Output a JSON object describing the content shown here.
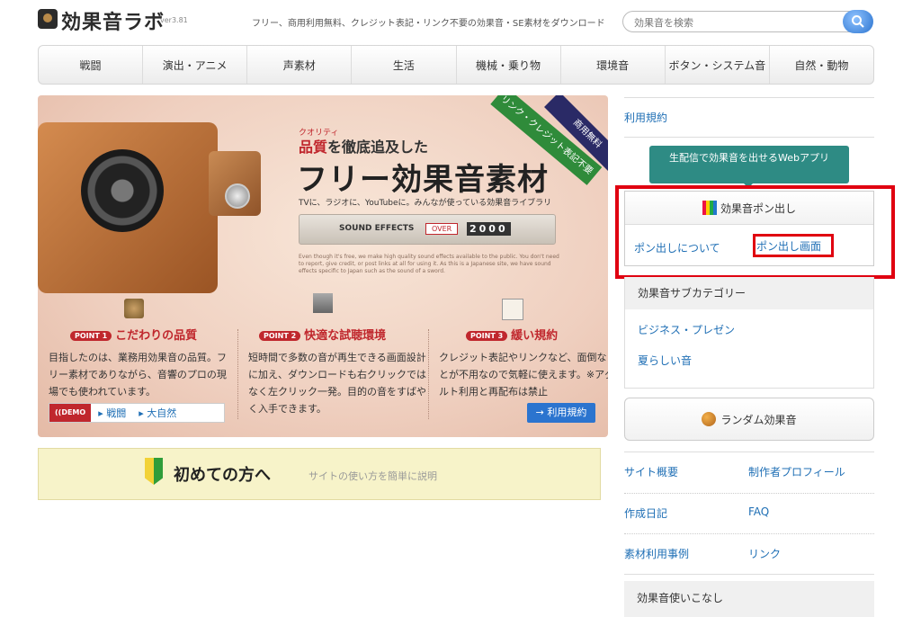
{
  "header": {
    "logo_text": "効果音ラボ",
    "version": "ver3.81",
    "tagline": "フリー、商用利用無料、クレジット表記・リンク不要の効果音・SE素材をダウンロード",
    "search_placeholder": "効果音を検索"
  },
  "nav": {
    "items": [
      "戦闘",
      "演出・アニメ",
      "声素材",
      "生活",
      "機械・乗り物",
      "環境音",
      "ボタン・システム音",
      "自然・動物"
    ]
  },
  "hero": {
    "ribbon_credit": "リンク・クレジット表記不要",
    "ribbon_free": "商用無料",
    "quality_ruby": "クオリティ",
    "subtitle_red": "品質",
    "subtitle_rest": "を徹底追及した",
    "title": "フリー効果音素材",
    "description": "TVに、ラジオに、YouTubeに。みんなが使っている効果音ライブラリ",
    "sfx_label": "SOUND EFFECTS",
    "sfx_over": "OVER",
    "sfx_count": "2000",
    "small_text": "Even though it's free, we make high quality sound effects available to the public. You don't need to report, give credit, or post links at all for using it. As this is a Japanese site, we have sound effects specific to Japan such as the sound of a sword.",
    "points": [
      {
        "badge": "POINT 1",
        "title": "こだわりの品質",
        "body": "目指したのは、業務用効果音の品質。フリー素材でありながら、音響のプロの現場でも使われています。"
      },
      {
        "badge": "POINT 2",
        "title": "快適な試聴環境",
        "body": "短時間で多数の音が再生できる画面設計に加え、ダウンロードも右クリックではなく左クリック一発。目的の音をすばやく入手できます。"
      },
      {
        "badge": "POINT 3",
        "title": "緩い規約",
        "body": "クレジット表記やリンクなど、面倒なことが不用なので気軽に使えます。※アダルト利用と再配布は禁止"
      }
    ],
    "demo_badge": "((DEMO",
    "demo_links": [
      "▸ 戦闘",
      "▸ 大自然"
    ],
    "terms_button": "→ 利用規約"
  },
  "beginners": {
    "title": "初めての方へ",
    "subtitle": "サイトの使い方を簡単に説明"
  },
  "sidebar": {
    "terms": "利用規約",
    "stream_button": "生配信で効果音を出せるWebアプリ",
    "pon_title": "効果音ポン出し",
    "pon_about": "ポン出しについて",
    "pon_screen": "ポン出し画面",
    "subcategory_title": "効果音サブカテゴリー",
    "subcategories": [
      "ビジネス・プレゼン",
      "夏らしい音"
    ],
    "random": "ランダム効果音",
    "links": [
      [
        "サイト概要",
        "制作者プロフィール"
      ],
      [
        "作成日記",
        "FAQ"
      ],
      [
        "素材利用事例",
        "リンク"
      ]
    ],
    "tips": "効果音使いこなし"
  },
  "colors": {
    "accent_red": "#c0272d",
    "highlight_red": "#e00010",
    "link_blue": "#1f6fb5",
    "teal": "#2e8b84"
  }
}
